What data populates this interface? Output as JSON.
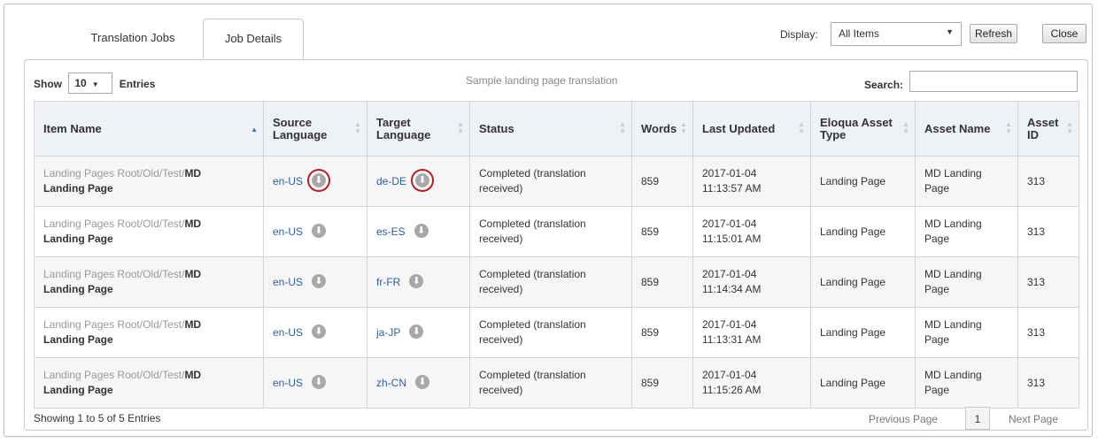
{
  "tabs": [
    {
      "label": "Translation Jobs",
      "active": false
    },
    {
      "label": "Job Details",
      "active": true
    }
  ],
  "toolbar": {
    "display_label": "Display:",
    "display_value": "All Items",
    "refresh_label": "Refresh",
    "close_label": "Close"
  },
  "panel": {
    "show_label": "Show",
    "entries_value": "10",
    "entries_label": "Entries",
    "caption": "Sample landing page translation",
    "search_label": "Search:",
    "search_value": ""
  },
  "table": {
    "columns": [
      "Item Name",
      "Source Language",
      "Target Language",
      "Status",
      "Words",
      "Last Updated",
      "Eloqua Asset Type",
      "Asset Name",
      "Asset ID"
    ],
    "rows": [
      {
        "path": "Landing Pages Root/Old/Test/",
        "name_a": "MD",
        "name_b": "Landing Page",
        "source": "en-US",
        "target": "de-DE",
        "status": "Completed (translation received)",
        "words": "859",
        "date": "2017-01-04",
        "time": "11:13:57 AM",
        "type": "Landing Page",
        "asset_name": "MD Landing Page",
        "asset_id": "313"
      },
      {
        "path": "Landing Pages Root/Old/Test/",
        "name_a": "MD",
        "name_b": "Landing Page",
        "source": "en-US",
        "target": "es-ES",
        "status": "Completed (translation received)",
        "words": "859",
        "date": "2017-01-04",
        "time": "11:15:01 AM",
        "type": "Landing Page",
        "asset_name": "MD Landing Page",
        "asset_id": "313"
      },
      {
        "path": "Landing Pages Root/Old/Test/",
        "name_a": "MD",
        "name_b": "Landing Page",
        "source": "en-US",
        "target": "fr-FR",
        "status": "Completed (translation received)",
        "words": "859",
        "date": "2017-01-04",
        "time": "11:14:34 AM",
        "type": "Landing Page",
        "asset_name": "MD Landing Page",
        "asset_id": "313"
      },
      {
        "path": "Landing Pages Root/Old/Test/",
        "name_a": "MD",
        "name_b": "Landing Page",
        "source": "en-US",
        "target": "ja-JP",
        "status": "Completed (translation received)",
        "words": "859",
        "date": "2017-01-04",
        "time": "11:13:31 AM",
        "type": "Landing Page",
        "asset_name": "MD Landing Page",
        "asset_id": "313"
      },
      {
        "path": "Landing Pages Root/Old/Test/",
        "name_a": "MD",
        "name_b": "Landing Page",
        "source": "en-US",
        "target": "zh-CN",
        "status": "Completed (translation received)",
        "words": "859",
        "date": "2017-01-04",
        "time": "11:15:26 AM",
        "type": "Landing Page",
        "asset_name": "MD Landing Page",
        "asset_id": "313"
      }
    ]
  },
  "footer": {
    "info": "Showing 1 to 5 of 5 Entries",
    "prev_label": "Previous Page",
    "page": "1",
    "next_label": "Next Page"
  },
  "icons": {
    "download": "download-icon",
    "sort": "sort-icon",
    "caret": "caret-down-icon"
  },
  "colors": {
    "link": "#2c5f9e",
    "highlight": "#b71c1c",
    "header_bg": "#eef1f5"
  }
}
